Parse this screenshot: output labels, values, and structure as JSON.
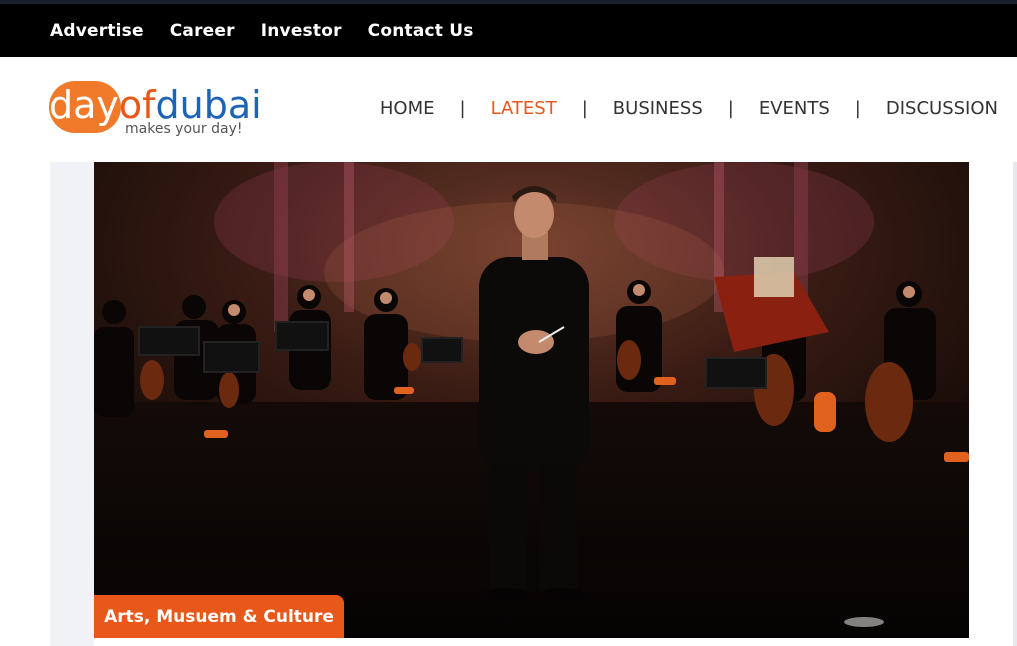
{
  "topbar": {
    "links": [
      "Advertise",
      "Career",
      "Investor",
      "Contact Us"
    ]
  },
  "logo": {
    "word_day": "day",
    "word_of": "of",
    "word_dubai": "dubai",
    "tagline": "makes your day!"
  },
  "nav": {
    "items": [
      "HOME",
      "LATEST",
      "BUSINESS",
      "EVENTS",
      "DISCUSSION"
    ],
    "active": "LATEST",
    "separator": "|"
  },
  "hero": {
    "category": "Arts, Musuem & Culture"
  },
  "colors": {
    "accent": "#e8581a",
    "brand_blue": "#1e63b4",
    "topbar_bg": "#000000"
  }
}
